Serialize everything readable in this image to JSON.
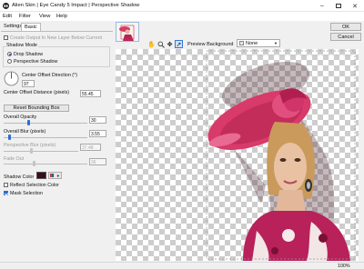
{
  "window": {
    "title": "Alien Skin | Eye Candy 5 Impact | Perspective Shadow"
  },
  "menu": [
    "Edit",
    "Filter",
    "View",
    "Help"
  ],
  "tabs": {
    "settings": "Settings",
    "basic": "Basic"
  },
  "controls": {
    "create_output_label": "Create Output In New Layer Below Current",
    "shadow_mode_label": "Shadow Mode",
    "drop_shadow_label": "Drop Shadow",
    "perspective_shadow_label": "Perspective Shadow",
    "center_offset_direction_label": "Center Offset Direction (°)",
    "center_offset_direction_value": "97",
    "center_offset_distance_label": "Center Offset Distance (pixels)",
    "center_offset_distance_value": "55.45",
    "reset_bounding_box_label": "Reset Bounding Box",
    "overall_opacity_label": "Overall Opacity",
    "overall_opacity_value": "30",
    "overall_blur_label": "Overall Blur (pixels)",
    "overall_blur_value": "3.55",
    "perspective_blur_label": "Perspective Blur (pixels)",
    "perspective_blur_value": "37.48",
    "fade_out_label": "Fade Out",
    "fade_out_value": "36",
    "shadow_color_label": "Shadow Color",
    "shadow_color": "#3a0d1a",
    "reflect_selection_color_label": "Reflect Selection Color",
    "mask_selection_label": "Mask Selection",
    "create_output_checked": false,
    "drop_shadow_selected": true,
    "reflect_checked": false,
    "mask_checked": true,
    "slider_levels": {
      "overall_opacity": 0.3,
      "overall_blur": 0.07,
      "perspective_blur": 0.37,
      "fade_out": 0.36
    }
  },
  "preview": {
    "background_label": "Preview Background",
    "background_value": "None"
  },
  "buttons": {
    "ok": "OK",
    "cancel": "Cancel"
  },
  "status": {
    "zoom": "100%"
  },
  "colors": {
    "accent": "#2d6dd2",
    "hat": "#d83a6a",
    "dress": "#b8215a"
  }
}
